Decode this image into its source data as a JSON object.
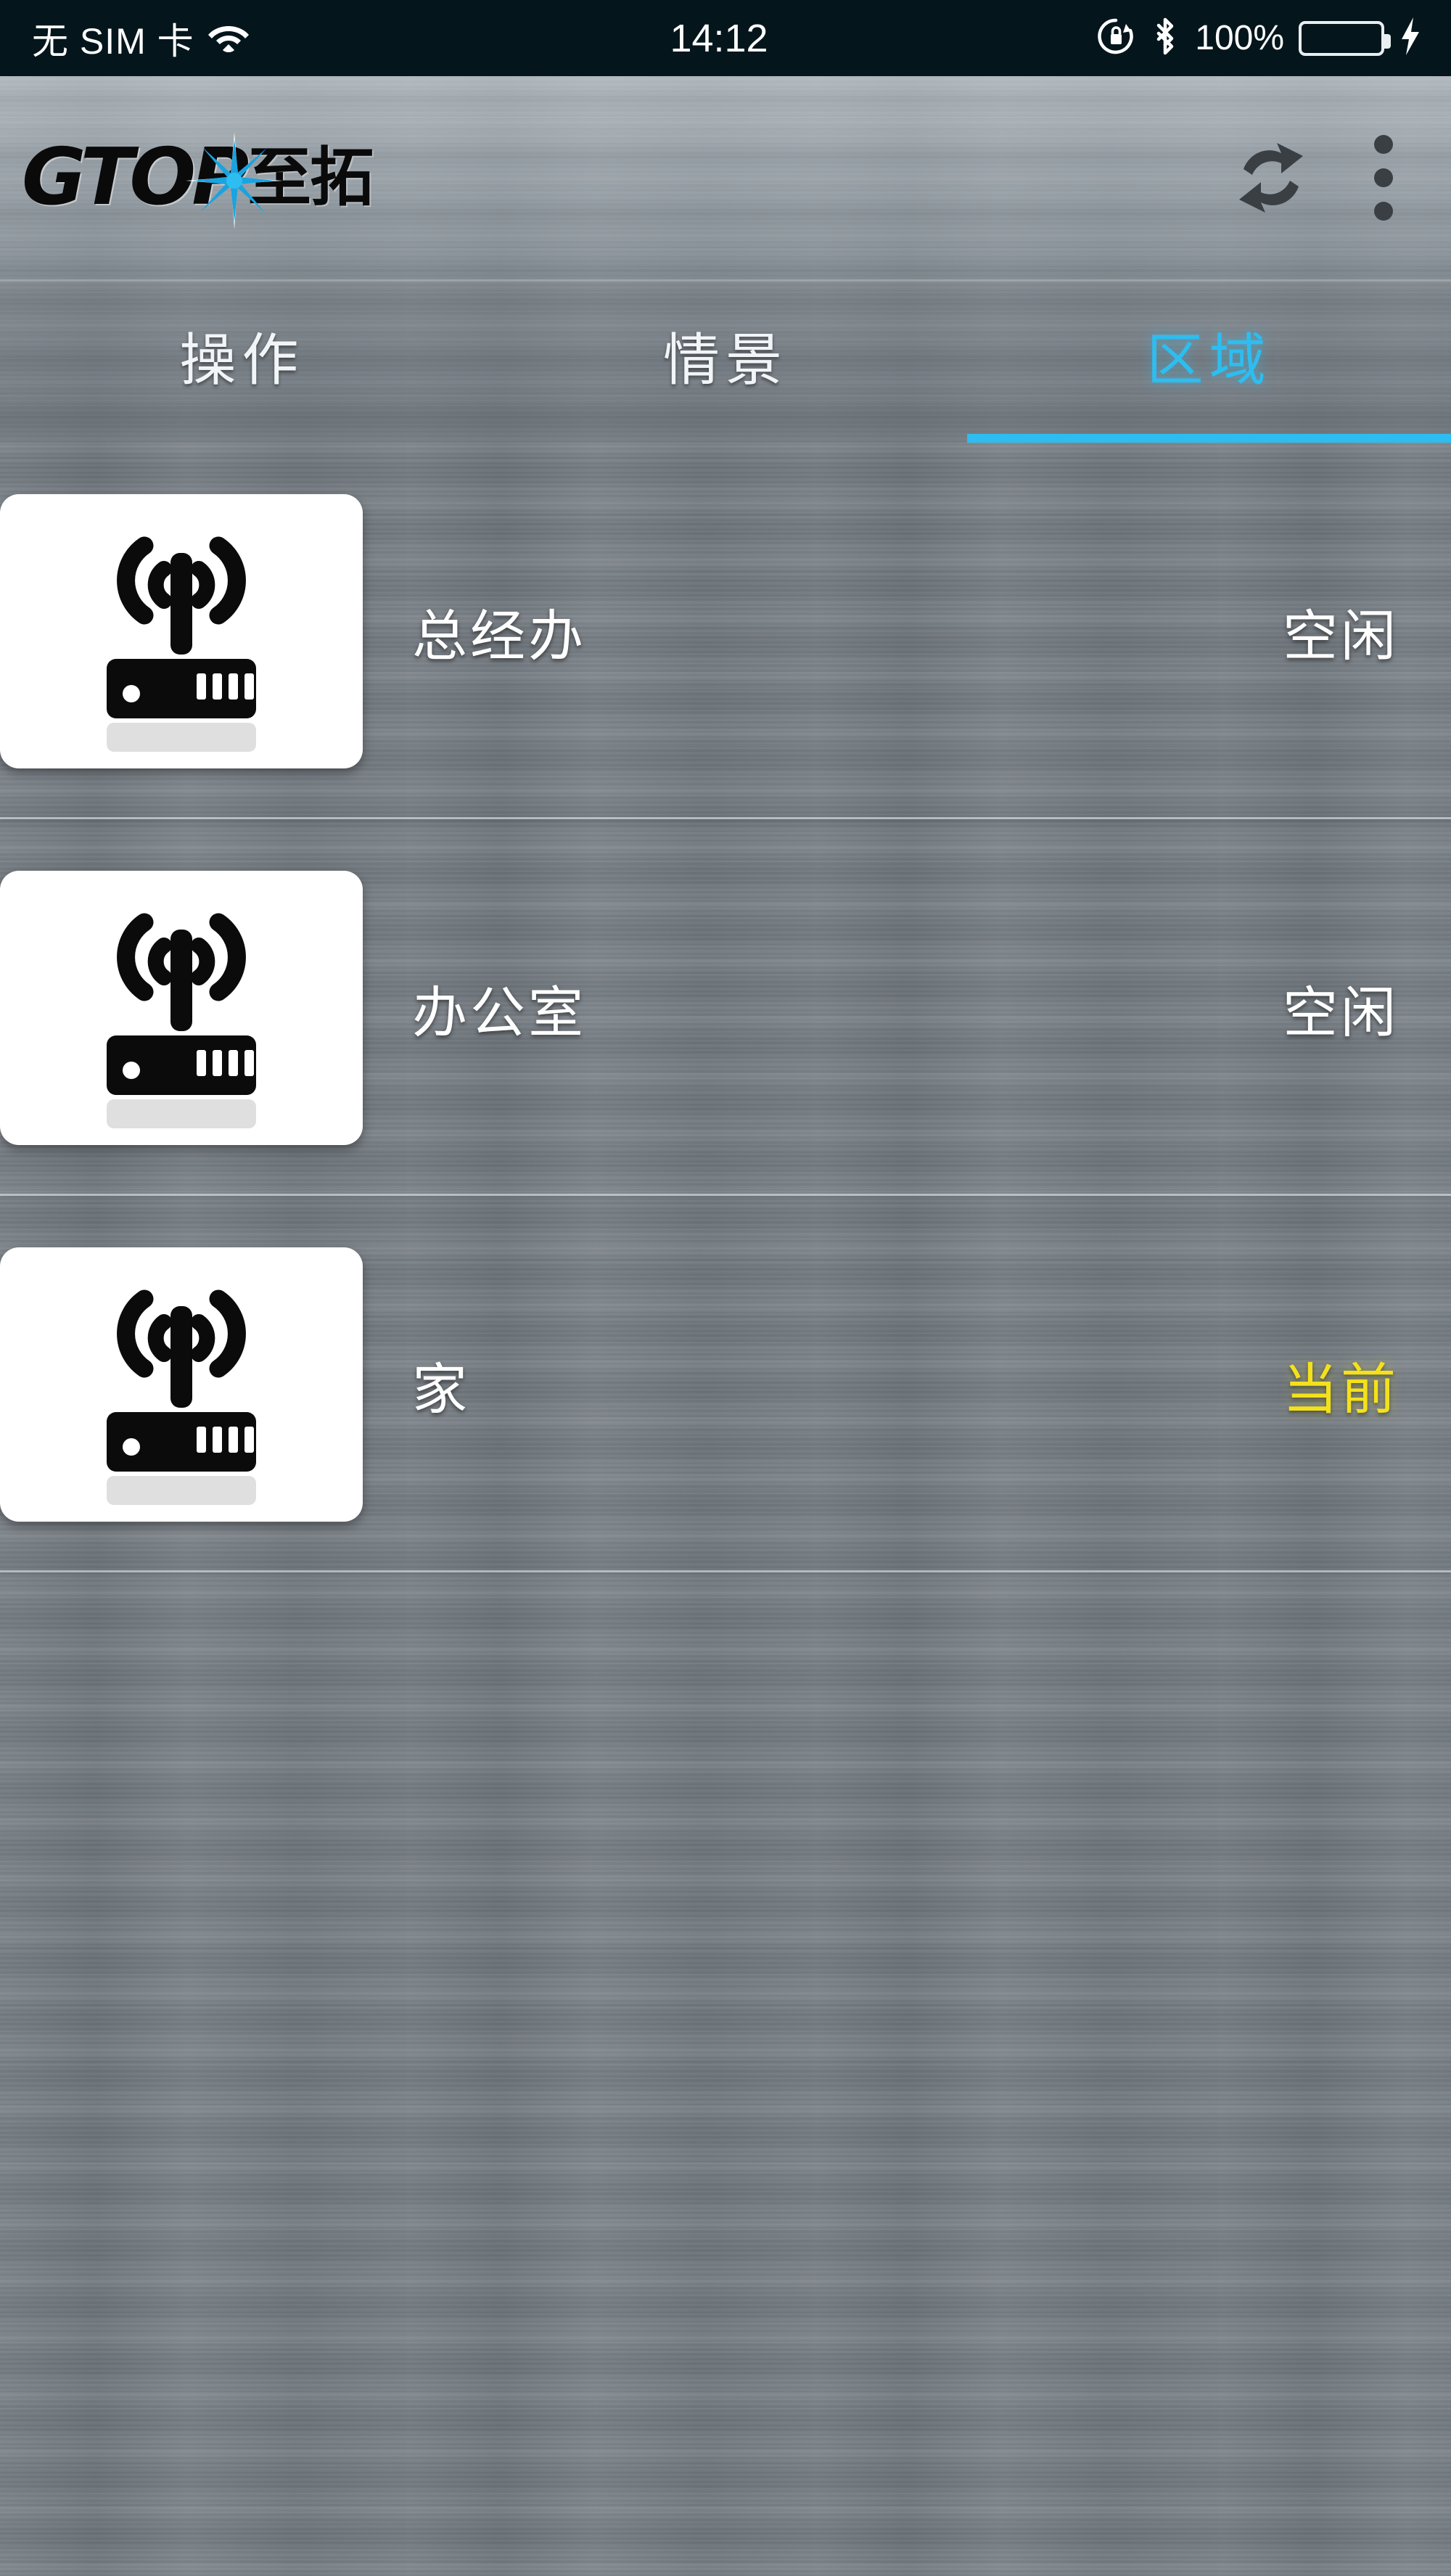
{
  "status_bar": {
    "carrier": "无 SIM 卡",
    "wifi_icon": "wifi-icon",
    "time": "14:12",
    "rotation_lock_icon": "rotation-lock-icon",
    "bluetooth_icon": "bluetooth-icon",
    "battery_percent": "100%",
    "battery_icon": "battery-full-icon",
    "charging_icon": "charging-bolt-icon",
    "battery_color": "#4cd551",
    "background_color": "#04161c"
  },
  "header": {
    "logo_text": "GTOP",
    "logo_suffix": "至拓",
    "logo_star_icon": "starburst-icon",
    "logo_star_color": "#1aa3e0",
    "refresh_label": "refresh-icon",
    "menu_label": "overflow-menu-icon"
  },
  "tabs": {
    "active_index": 2,
    "accent_color": "#2ebdf0",
    "items": [
      {
        "label": "操作"
      },
      {
        "label": "情景"
      },
      {
        "label": "区域"
      }
    ]
  },
  "list": {
    "item_icon": "wireless-router-icon",
    "status_colors": {
      "idle": "#ffffff",
      "current": "#f4e11c"
    },
    "items": [
      {
        "title": "总经办",
        "status": "空闲",
        "status_type": "idle"
      },
      {
        "title": "办公室",
        "status": "空闲",
        "status_type": "idle"
      },
      {
        "title": "家",
        "status": "当前",
        "status_type": "current"
      }
    ]
  }
}
